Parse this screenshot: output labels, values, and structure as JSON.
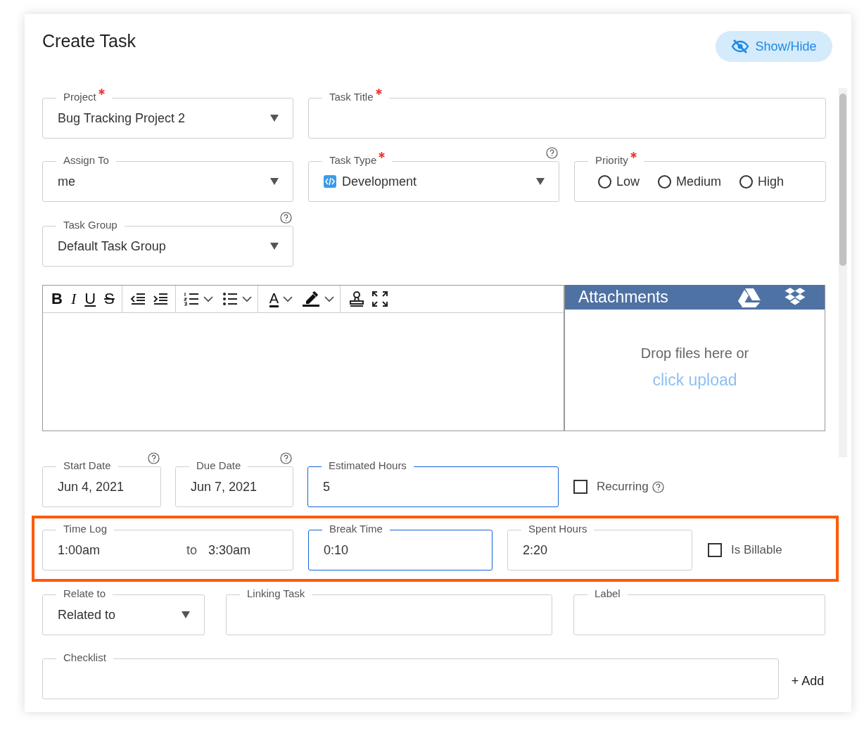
{
  "title": "Create Task",
  "show_hide_button": "Show/Hide",
  "project": {
    "label": "Project",
    "required": true,
    "focused": false,
    "value": "Bug Tracking Project 2"
  },
  "task_title": {
    "label": "Task Title",
    "required": true,
    "focused": false
  },
  "assign_to": {
    "label": "Assign To",
    "required": false,
    "focused": false,
    "value": "me"
  },
  "task_type": {
    "label": "Task Type",
    "required": true,
    "help": true,
    "focused": false,
    "value": "Development"
  },
  "priority": {
    "label": "Priority",
    "required": true,
    "options": [
      {
        "label": "Low",
        "selected": false
      },
      {
        "label": "Medium",
        "selected": false
      },
      {
        "label": "High",
        "selected": false
      }
    ]
  },
  "task_group": {
    "label": "Task Group",
    "required": false,
    "help": true,
    "focused": false,
    "value": "Default Task Group"
  },
  "toolbar": [
    {
      "kind": "bold",
      "glyph": "B"
    },
    {
      "kind": "italic",
      "glyph": "I"
    },
    {
      "kind": "underline",
      "glyph": "U"
    },
    {
      "kind": "strike",
      "glyph": "S"
    },
    {
      "kind": "outdent"
    },
    {
      "kind": "indent"
    },
    {
      "kind": "ordered-list"
    },
    {
      "kind": "bullet-list"
    },
    {
      "kind": "font-color",
      "glyph": "A"
    },
    {
      "kind": "highlight"
    },
    {
      "kind": "stamp"
    },
    {
      "kind": "fullscreen"
    }
  ],
  "attachments": {
    "title": "Attachments",
    "drop_text": "Drop files here or",
    "upload_link": "click upload"
  },
  "start_date": {
    "label": "Start Date",
    "required": false,
    "help": true,
    "focused": false,
    "value": "Jun 4, 2021"
  },
  "due_date": {
    "label": "Due Date",
    "required": false,
    "help": true,
    "focused": false,
    "value": "Jun 7, 2021"
  },
  "estimated_hours": {
    "label": "Estimated Hours",
    "required": false,
    "focused": true,
    "value": "5"
  },
  "recurring": {
    "label": "Recurring",
    "checked": false,
    "help": true
  },
  "time_row": {
    "highlighted": true
  },
  "time_log": {
    "label": "Time Log",
    "required": false,
    "focused": false,
    "from": "1:00am",
    "separator": "to",
    "to": "3:30am"
  },
  "break_time": {
    "label": "Break Time",
    "required": false,
    "focused": true,
    "value": "0:10"
  },
  "spent_hours": {
    "label": "Spent Hours",
    "required": false,
    "focused": false,
    "value": "2:20"
  },
  "is_billable": {
    "label": "Is Billable",
    "checked": false
  },
  "relate_to": {
    "label": "Relate to",
    "required": false,
    "focused": false,
    "value": "Related to"
  },
  "linking_task": {
    "label": "Linking Task",
    "required": false,
    "focused": false
  },
  "label": {
    "label": "Label",
    "required": false,
    "focused": false
  },
  "checklist": {
    "label": "Checklist",
    "required": false,
    "focused": false
  },
  "add_button": "+ Add"
}
